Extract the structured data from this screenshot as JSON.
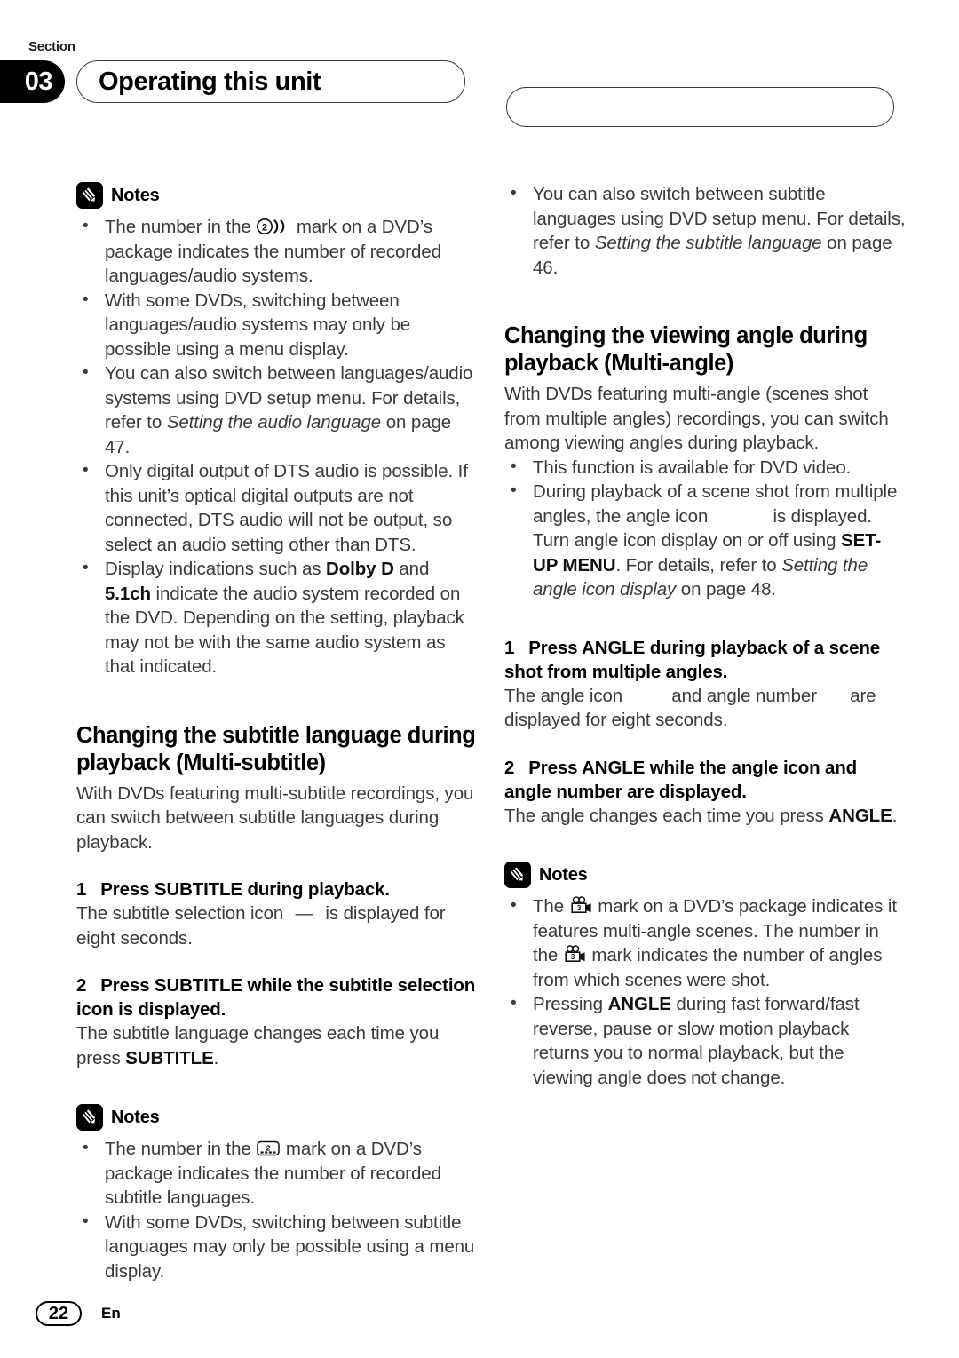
{
  "header": {
    "section_word": "Section",
    "section_number": "03",
    "title": "Operating this unit"
  },
  "footer": {
    "page_number": "22",
    "language_code": "En"
  },
  "notes_label": "Notes",
  "left_column": {
    "notes_1": {
      "label": "Notes",
      "items": [
        {
          "pre": "The number in the ",
          "mark": "audio-mark-2",
          "post": " mark on a DVD’s package indicates the number of recorded languages/audio systems."
        },
        {
          "text": "With some DVDs, switching between languages/audio systems may only be possible using a menu display."
        },
        {
          "pre": "You can also switch between languages/audio systems using DVD setup menu. For details, refer to ",
          "italic": "Setting the audio language",
          "post": " on page 47."
        },
        {
          "text": "Only digital output of DTS audio is possible. If this unit’s optical digital outputs are not connected, DTS audio will not be output, so select an audio setting other than DTS."
        },
        {
          "pre": "Display indications such as ",
          "bold1": "Dolby D",
          "mid": " and ",
          "bold2": "5.1ch",
          "post": " indicate the audio system recorded on the DVD. Depending on the setting, playback may not be with the same audio system as that indicated."
        }
      ]
    },
    "heading": "Changing the subtitle language during playback (Multi-subtitle)",
    "intro": "With DVDs featuring multi-subtitle recordings, you can switch between subtitle languages during playback.",
    "step_1": {
      "number": "1",
      "title": "Press SUBTITLE during playback.",
      "body_pre": "The subtitle selection icon ",
      "body_icon": "subtitle-selection-icon",
      "body_post": " is displayed for eight seconds."
    },
    "step_2": {
      "number": "2",
      "title": "Press SUBTITLE while the subtitle selection icon is displayed.",
      "body_pre": "The subtitle language changes each time you press ",
      "body_bold": "SUBTITLE",
      "body_post": "."
    },
    "notes_2": {
      "label": "Notes",
      "items": [
        {
          "pre": "The number in the ",
          "mark": "subtitle-mark-2",
          "post": " mark on a DVD’s package indicates the number of recorded subtitle languages."
        },
        {
          "text": "With some DVDs, switching between subtitle languages may only be possible using a menu display."
        }
      ]
    }
  },
  "right_column": {
    "top_note": {
      "pre": "You can also switch between subtitle languages using DVD setup menu. For details, refer to ",
      "italic": "Setting the subtitle language",
      "post": " on page 46."
    },
    "heading": "Changing the viewing angle during playback (Multi-angle)",
    "intro": "With DVDs featuring multi-angle (scenes shot from multiple angles) recordings, you can switch among viewing angles during playback.",
    "bullets": [
      {
        "text": "This function is available for DVD video."
      },
      {
        "pre": "During playback of a scene shot from multiple angles, the angle icon ",
        "icon": "angle-icon-placeholder",
        "mid": " is displayed. Turn angle icon display on or off using ",
        "bold": "SET-UP MENU",
        "mid2": ". For details, refer to ",
        "italic": "Setting the angle icon display",
        "post": " on page 48."
      }
    ],
    "step_1": {
      "number": "1",
      "title": "Press ANGLE during playback of a scene shot from multiple angles.",
      "body_pre": "The angle icon ",
      "body_icon1": "angle-icon-placeholder",
      "body_mid": " and angle number ",
      "body_icon2": "angle-number-placeholder",
      "body_post": " are displayed for eight seconds."
    },
    "step_2": {
      "number": "2",
      "title": "Press ANGLE while the angle icon and angle number are displayed.",
      "body_pre": "The angle changes each time you press ",
      "body_bold": "ANGLE",
      "body_post": "."
    },
    "notes": {
      "label": "Notes",
      "items": [
        {
          "pre": "The ",
          "mark1": "angle-mark-3",
          "mid": " mark on a DVD’s package indicates it features multi-angle scenes. The number in the ",
          "mark2": "angle-mark-3",
          "post": " mark indicates the number of angles from which scenes were shot."
        },
        {
          "pre": "Pressing ",
          "bold": "ANGLE",
          "post": " during fast forward/fast reverse, pause or slow motion playback returns you to normal playback, but the viewing angle does not change."
        }
      ]
    }
  },
  "colors": {
    "ink": "#231f20",
    "body": "#3a3a3a",
    "black": "#000000",
    "paper": "#ffffff"
  }
}
